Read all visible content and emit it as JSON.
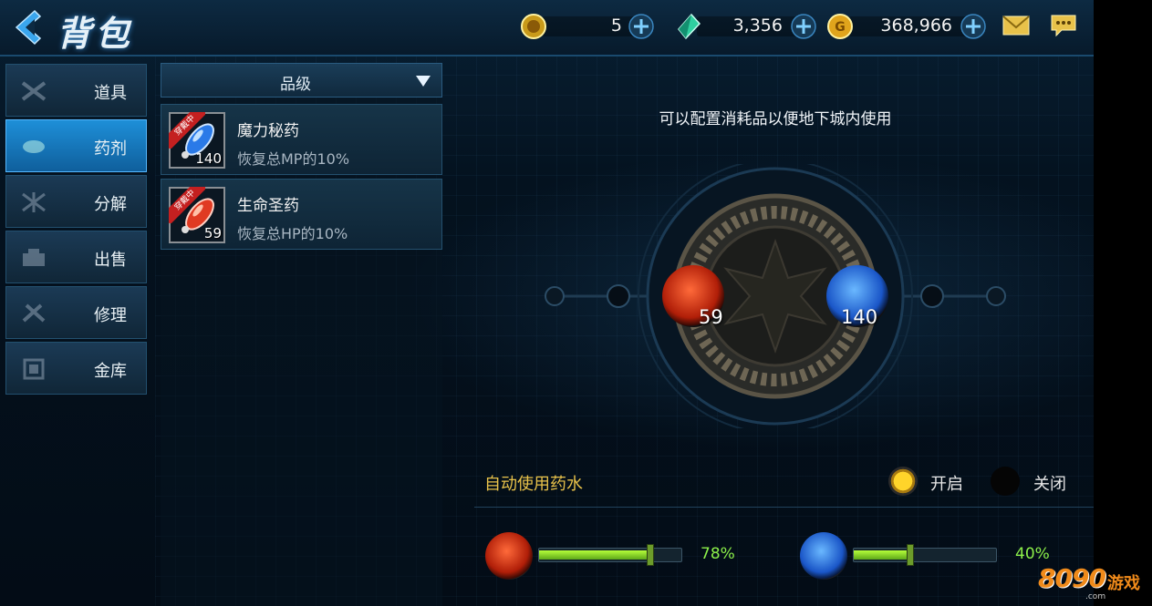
{
  "header": {
    "title": "背包",
    "resources": [
      {
        "icon": "gold-token-icon",
        "value": "5"
      },
      {
        "icon": "green-crystal-icon",
        "value": "3,356"
      },
      {
        "icon": "gold-coin-icon",
        "value": "368,966"
      }
    ]
  },
  "menu": {
    "items": [
      {
        "label": "道具",
        "icon": "items-icon",
        "active": false
      },
      {
        "label": "药剂",
        "icon": "potion-icon",
        "active": true
      },
      {
        "label": "分解",
        "icon": "decompose-icon",
        "active": false
      },
      {
        "label": "出售",
        "icon": "sell-icon",
        "active": false
      },
      {
        "label": "修理",
        "icon": "repair-icon",
        "active": false
      },
      {
        "label": "金库",
        "icon": "vault-icon",
        "active": false
      }
    ]
  },
  "list": {
    "sort_label": "品级",
    "items": [
      {
        "name": "魔力秘药",
        "desc": "恢复总MP的10%",
        "count": "140",
        "badge": "穿戴中",
        "color": "blue"
      },
      {
        "name": "生命圣药",
        "desc": "恢复总HP的10%",
        "count": "59",
        "badge": "穿戴中",
        "color": "red"
      }
    ]
  },
  "config": {
    "hint": "可以配置消耗品以便地下城内使用",
    "left_slot_count": "59",
    "right_slot_count": "140"
  },
  "auto_use": {
    "label": "自动使用药水",
    "on_label": "开启",
    "off_label": "关闭",
    "enabled": true,
    "hp_threshold_text": "78%",
    "hp_threshold": 0.78,
    "mp_threshold_text": "40%",
    "mp_threshold": 0.4
  },
  "watermark": {
    "brand": "8090",
    "brand_cn": "游戏",
    "domain": ".com"
  },
  "colors": {
    "accent": "#1e8fd8",
    "gold": "#e8c24a",
    "green": "#8cf04a",
    "red_potion": "#e03a22",
    "blue_potion": "#2a7ae8"
  }
}
